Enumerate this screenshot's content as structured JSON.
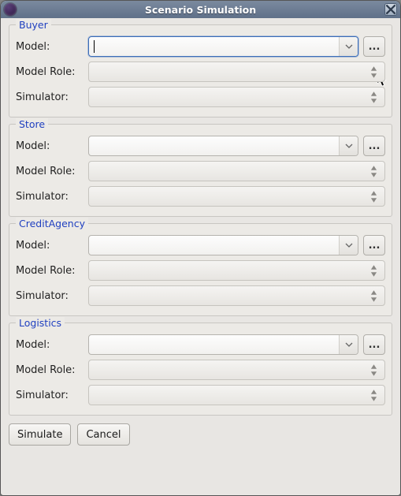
{
  "window": {
    "title": "Scenario Simulation"
  },
  "groups": [
    {
      "legend": "Buyer",
      "rows": {
        "model_label": "Model:",
        "model_value": "",
        "role_label": "Model Role:",
        "role_value": "",
        "sim_label": "Simulator:",
        "sim_value": ""
      },
      "active_model": true
    },
    {
      "legend": "Store",
      "rows": {
        "model_label": "Model:",
        "model_value": "",
        "role_label": "Model Role:",
        "role_value": "",
        "sim_label": "Simulator:",
        "sim_value": ""
      },
      "active_model": false
    },
    {
      "legend": "CreditAgency",
      "rows": {
        "model_label": "Model:",
        "model_value": "",
        "role_label": "Model Role:",
        "role_value": "",
        "sim_label": "Simulator:",
        "sim_value": ""
      },
      "active_model": false
    },
    {
      "legend": "Logistics",
      "rows": {
        "model_label": "Model:",
        "model_value": "",
        "role_label": "Model Role:",
        "role_value": "",
        "sim_label": "Simulator:",
        "sim_value": ""
      },
      "active_model": false
    }
  ],
  "buttons": {
    "simulate": "Simulate",
    "cancel": "Cancel",
    "browse": "..."
  }
}
